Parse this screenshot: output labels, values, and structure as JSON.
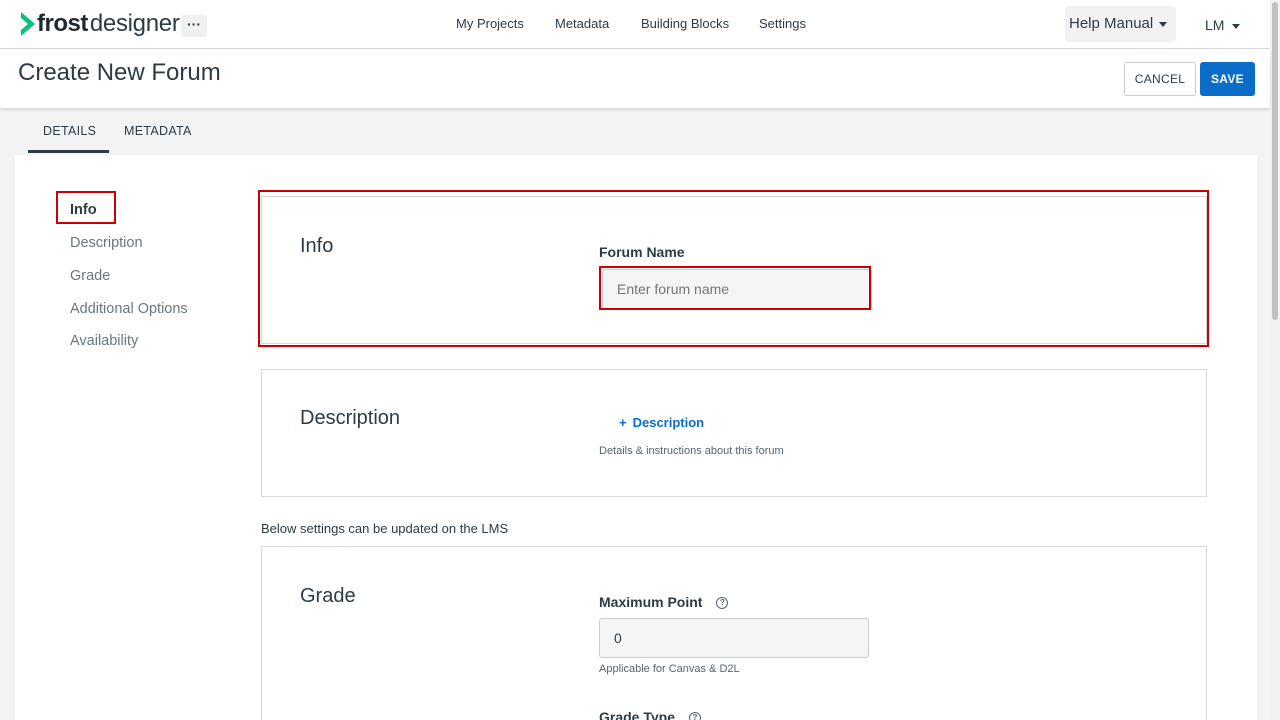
{
  "app": {
    "logo_bold": "frost",
    "logo_light": "designer",
    "more_label": "···"
  },
  "nav": {
    "items": [
      "My Projects",
      "Metadata",
      "Building Blocks",
      "Settings"
    ],
    "help_label": "Help Manual",
    "user_initials": "LM"
  },
  "header": {
    "title": "Create New Forum",
    "cancel_label": "CANCEL",
    "save_label": "SAVE"
  },
  "tabs": [
    {
      "label": "DETAILS",
      "active": true
    },
    {
      "label": "METADATA",
      "active": false
    }
  ],
  "sidebar": {
    "items": [
      {
        "label": "Info",
        "active": true
      },
      {
        "label": "Description",
        "active": false
      },
      {
        "label": "Grade",
        "active": false
      },
      {
        "label": "Additional Options",
        "active": false
      },
      {
        "label": "Availability",
        "active": false
      }
    ]
  },
  "info": {
    "title": "Info",
    "forum_name_label": "Forum Name",
    "forum_name_value": "",
    "forum_name_placeholder": "Enter forum name"
  },
  "description": {
    "title": "Description",
    "add_label": "Description",
    "add_icon": "+",
    "help": "Details & instructions about this forum"
  },
  "lms_note": "Below settings can be updated on the LMS",
  "grade": {
    "title": "Grade",
    "max_point_label": "Maximum Point",
    "max_point_value": "0",
    "max_point_help": "Applicable for Canvas & D2L",
    "grade_type_label": "Grade Type",
    "help_icon": "?"
  },
  "colors": {
    "accent": "#0b6dc8",
    "brand": "#08c17e",
    "highlight": "#cc0000"
  }
}
